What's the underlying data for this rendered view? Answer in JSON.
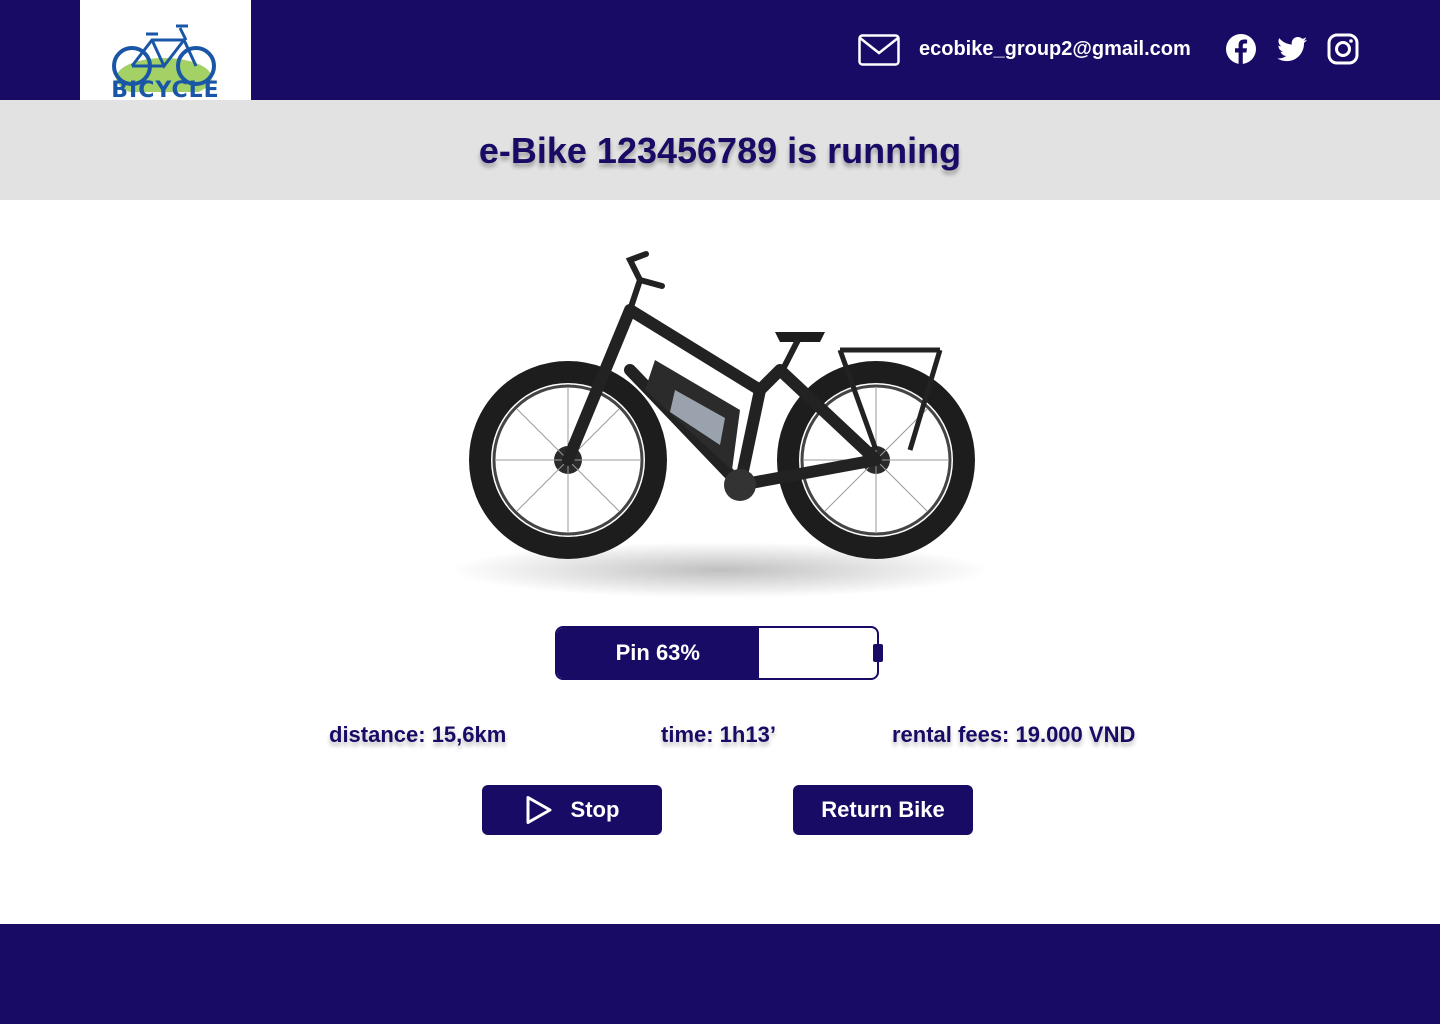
{
  "header": {
    "logo_text": "BICYCLE",
    "email": "ecobike_group2@gmail.com",
    "icons": [
      "mail-icon",
      "facebook-icon",
      "twitter-icon",
      "instagram-icon"
    ]
  },
  "banner": {
    "title": "e-Bike 123456789 is running"
  },
  "battery": {
    "label": "Pin 63%",
    "level": 0.63
  },
  "stats": {
    "distance": "distance: 15,6km",
    "time": "time: 1h13’",
    "fees": "rental fees: 19.000 VND"
  },
  "actions": {
    "stop_label": "Stop",
    "return_label": "Return Bike"
  },
  "colors": {
    "brand": "#180b66",
    "banner_bg": "#e3e2e2",
    "logo_blue": "#1a56a8",
    "logo_green": "#8cc63f"
  }
}
